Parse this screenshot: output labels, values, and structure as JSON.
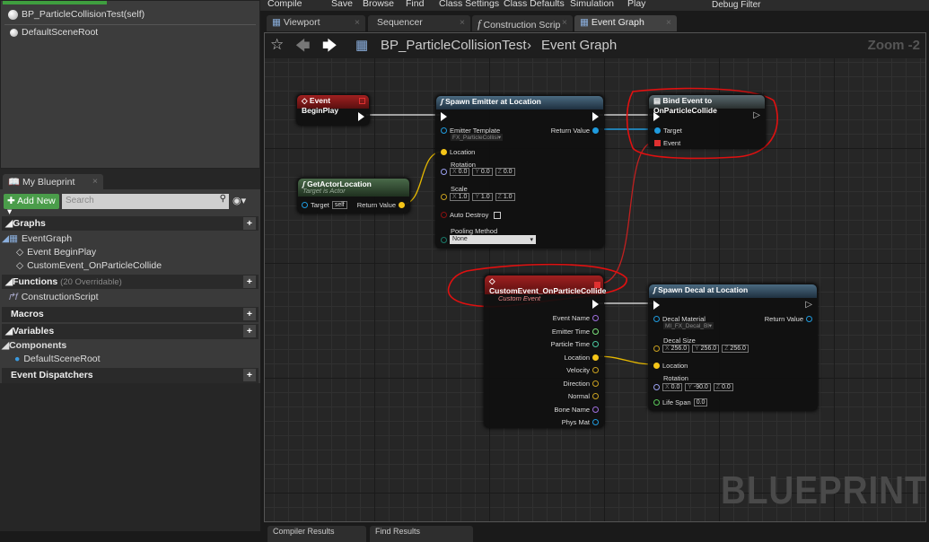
{
  "components": {
    "root_actor": "BP_ParticleCollisionTest(self)",
    "items": [
      "DefaultSceneRoot"
    ]
  },
  "toolbar": {
    "items": [
      "Compile",
      "Save",
      "Browse",
      "Find",
      "Class Settings",
      "Class Defaults",
      "Simulation",
      "Play"
    ],
    "debug_filter": "Debug Filter"
  },
  "tabs": [
    {
      "label": "Viewport",
      "icon": "viewport-icon"
    },
    {
      "label": "Sequencer"
    },
    {
      "label": "Construction Scrip",
      "icon": "function-icon"
    },
    {
      "label": "Event Graph",
      "icon": "graph-icon",
      "active": true
    }
  ],
  "breadcrumb": {
    "blueprint": "BP_ParticleCollisionTest",
    "separator": "›",
    "graph": "Event Graph",
    "zoom": "Zoom -2"
  },
  "my_blueprint": {
    "tab": "My Blueprint",
    "add_new": "Add New",
    "search_placeholder": "Search",
    "graphs": "Graphs",
    "event_graph": "EventGraph",
    "events": [
      "Event BeginPlay",
      "CustomEvent_OnParticleCollide"
    ],
    "functions": "Functions",
    "functions_count": "(20 Overridable)",
    "function_items": [
      "ConstructionScript"
    ],
    "macros": "Macros",
    "variables": "Variables",
    "components": "Components",
    "component_items": [
      "DefaultSceneRoot"
    ],
    "dispatchers": "Event Dispatchers"
  },
  "nodes": {
    "begin_play": {
      "title": "Event BeginPlay"
    },
    "get_actor_location": {
      "title": "GetActorLocation",
      "subtitle": "Target is Actor",
      "target": "Target",
      "target_value": "self",
      "return": "Return Value"
    },
    "spawn_emitter": {
      "title": "Spawn Emitter at Location",
      "emitter_template": "Emitter Template",
      "emitter_value": "FX_ParticleCollisi▾",
      "return": "Return Value",
      "location": "Location",
      "rotation": "Rotation",
      "rot": [
        "0.0",
        "0.0",
        "0.0"
      ],
      "scale": "Scale",
      "scl": [
        "1.0",
        "1.0",
        "1.0"
      ],
      "auto_destroy": "Auto Destroy",
      "pooling": "Pooling Method",
      "pooling_value": "None"
    },
    "bind_event": {
      "title": "Bind Event to OnParticleCollide",
      "target": "Target",
      "event": "Event"
    },
    "custom_event": {
      "title": "CustomEvent_OnParticleCollide",
      "subtitle": "Custom Event",
      "outputs": [
        "Event Name",
        "Emitter Time",
        "Particle Time",
        "Location",
        "Velocity",
        "Direction",
        "Normal",
        "Bone Name",
        "Phys Mat"
      ]
    },
    "spawn_decal": {
      "title": "Spawn Decal at Location",
      "decal_material": "Decal Material",
      "material_value": "MI_FX_Decal_Bl▾",
      "return": "Return Value",
      "decal_size": "Decal Size",
      "size": [
        "256.0",
        "256.0",
        "256.0"
      ],
      "location": "Location",
      "rotation": "Rotation",
      "rot": [
        "0.0",
        "-90.0",
        "0.0"
      ],
      "life_span": "Life Span",
      "life_value": "0.0"
    }
  },
  "axis_labels": [
    "X",
    "Y",
    "Z"
  ],
  "watermark": "BLUEPRINT",
  "bottom_tabs": [
    "Compiler Results",
    "Find Results"
  ],
  "colors": {
    "exec": "#ffffff",
    "vector": "#f5c518",
    "object": "#1f9bde",
    "rotator": "#9aa0f0",
    "delegate": "#e03030",
    "annotation": "#e01010"
  }
}
